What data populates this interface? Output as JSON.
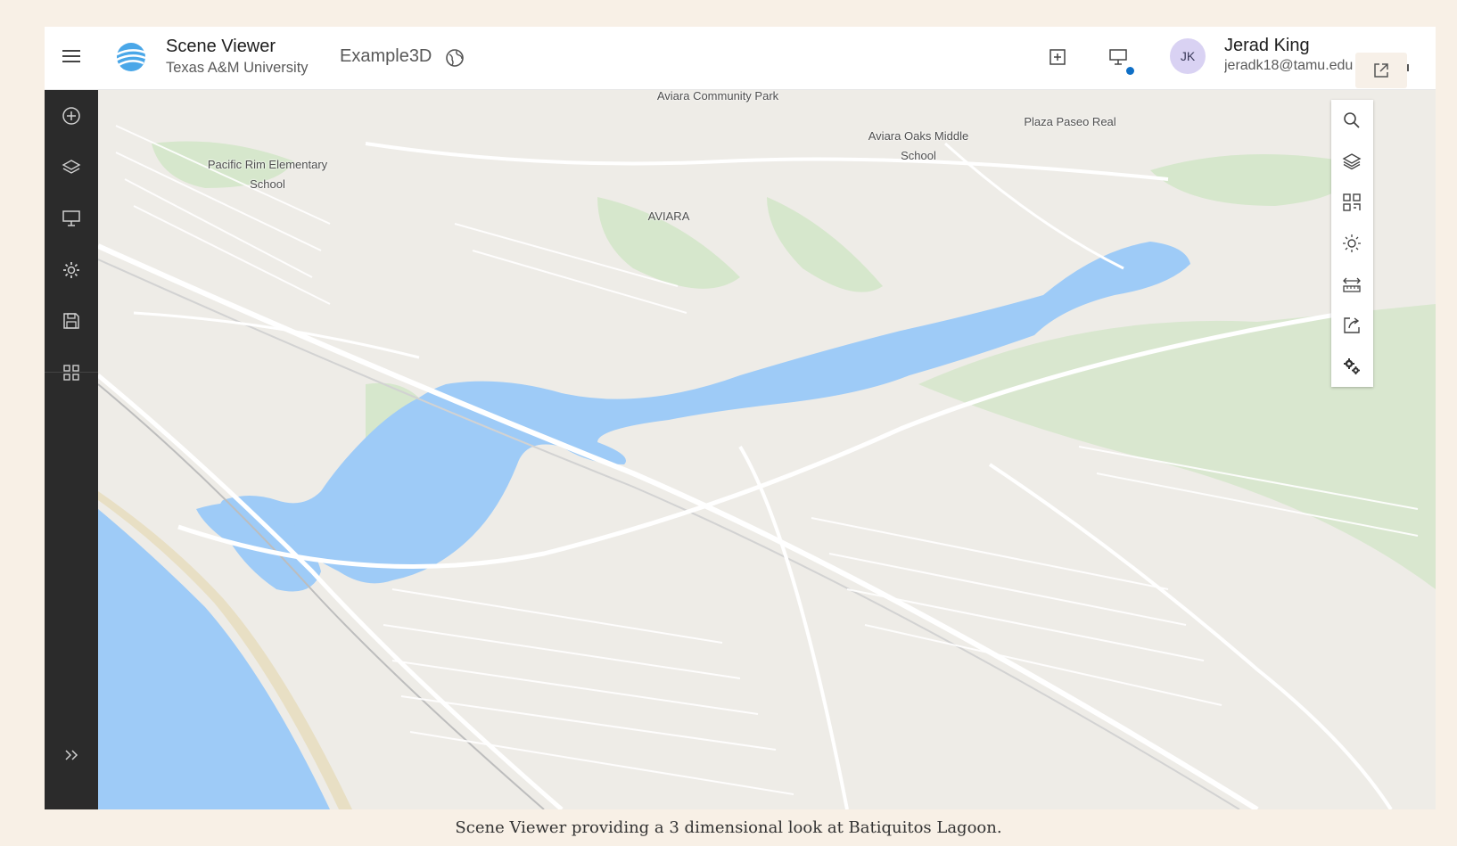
{
  "header": {
    "app_title": "Scene Viewer",
    "org_name": "Texas A&M University",
    "scene_name": "Example3D",
    "user": {
      "initials": "JK",
      "name": "Jerad King",
      "email": "jeradk18@tamu.edu"
    },
    "icons": [
      "menu-icon",
      "scene-viewer-logo-icon",
      "globe-icon",
      "new-scene-icon",
      "presentation-icon",
      "open-external-icon"
    ]
  },
  "sidebar": {
    "items": [
      "add-icon",
      "layers-icon",
      "slides-icon",
      "settings-icon",
      "save-icon",
      "apps-grid-icon"
    ],
    "expand_icon": "chevron-double-right-icon"
  },
  "map": {
    "labels": {
      "community_park": "Aviara Community Park",
      "plaza": "Plaza Paseo Real",
      "middle_school": "Aviara Oaks Middle\nSchool",
      "elementary": "Pacific Rim Elementary\nSchool",
      "aviara": "AVIARA"
    },
    "colors": {
      "water": "#9ecbf7",
      "land": "#eeece7",
      "park": "#d6e7cc",
      "roads": "#ffffff"
    }
  },
  "tools": [
    "search-icon",
    "basemap-layers-icon",
    "qr-code-icon",
    "daylight-icon",
    "measure-icon",
    "share-icon",
    "settings-gear-icon"
  ],
  "caption": "Scene Viewer providing a 3 dimensional look at Batiquitos Lagoon."
}
